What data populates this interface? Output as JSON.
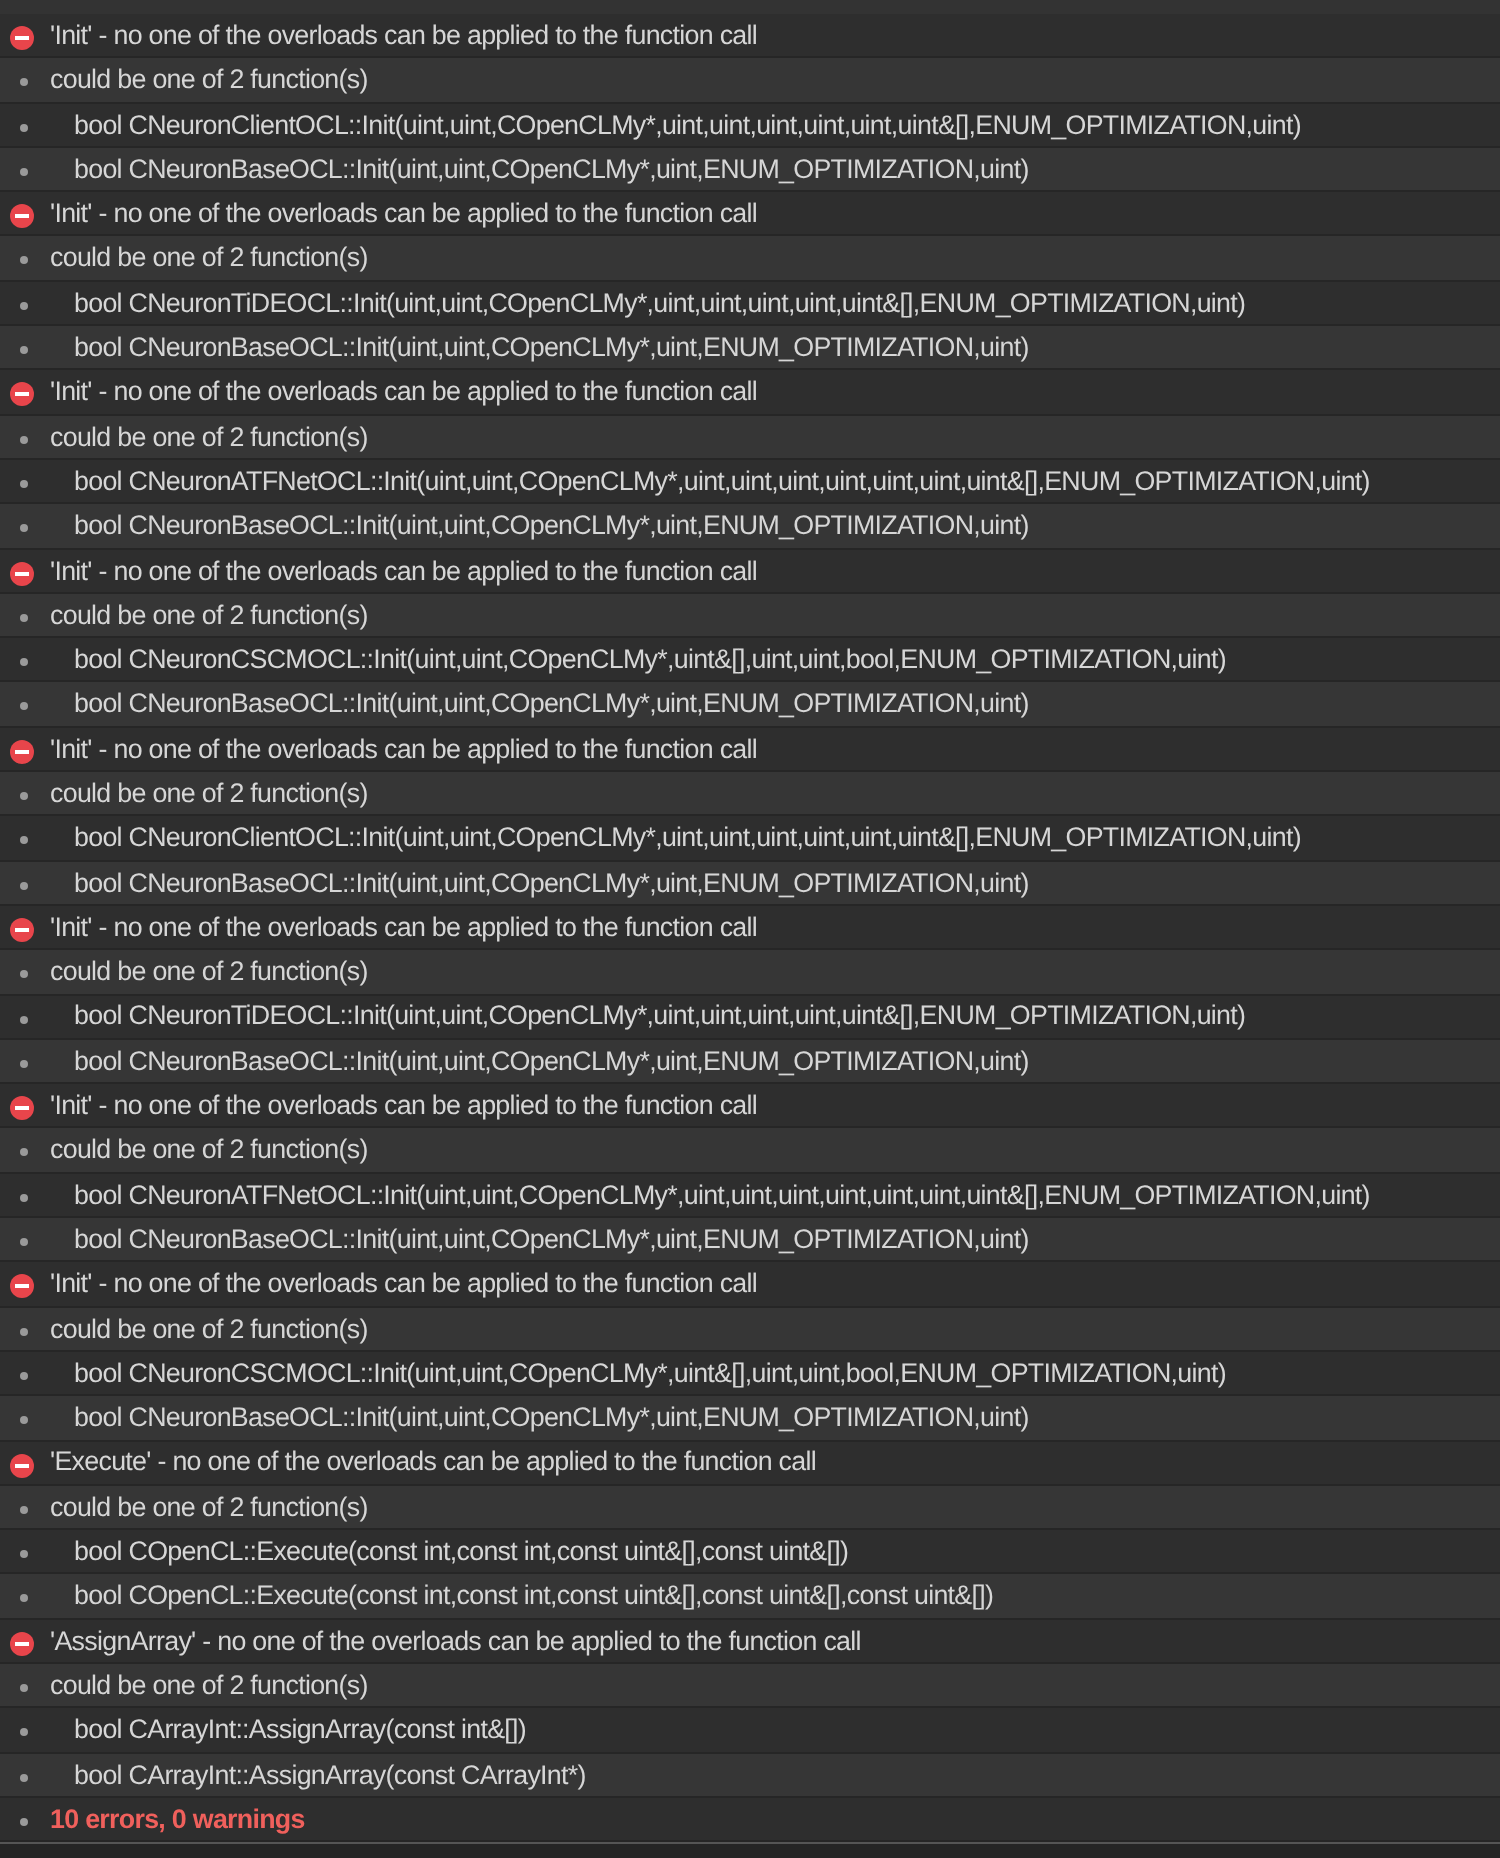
{
  "messages": [
    {
      "kind": "error",
      "text": "'Init' - no one of the overloads can be applied to the function call"
    },
    {
      "kind": "info",
      "text": "could be one of 2 function(s)"
    },
    {
      "kind": "candidate",
      "text": "bool CNeuronClientOCL::Init(uint,uint,COpenCLMy*,uint,uint,uint,uint,uint,uint&[],ENUM_OPTIMIZATION,uint)"
    },
    {
      "kind": "candidate",
      "text": "bool CNeuronBaseOCL::Init(uint,uint,COpenCLMy*,uint,ENUM_OPTIMIZATION,uint)"
    },
    {
      "kind": "error",
      "text": "'Init' - no one of the overloads can be applied to the function call"
    },
    {
      "kind": "info",
      "text": "could be one of 2 function(s)"
    },
    {
      "kind": "candidate",
      "text": "bool CNeuronTiDEOCL::Init(uint,uint,COpenCLMy*,uint,uint,uint,uint,uint&[],ENUM_OPTIMIZATION,uint)"
    },
    {
      "kind": "candidate",
      "text": "bool CNeuronBaseOCL::Init(uint,uint,COpenCLMy*,uint,ENUM_OPTIMIZATION,uint)"
    },
    {
      "kind": "error",
      "text": "'Init' - no one of the overloads can be applied to the function call"
    },
    {
      "kind": "info",
      "text": "could be one of 2 function(s)"
    },
    {
      "kind": "candidate",
      "text": "bool CNeuronATFNetOCL::Init(uint,uint,COpenCLMy*,uint,uint,uint,uint,uint,uint,uint&[],ENUM_OPTIMIZATION,uint)"
    },
    {
      "kind": "candidate",
      "text": "bool CNeuronBaseOCL::Init(uint,uint,COpenCLMy*,uint,ENUM_OPTIMIZATION,uint)"
    },
    {
      "kind": "error",
      "text": "'Init' - no one of the overloads can be applied to the function call"
    },
    {
      "kind": "info",
      "text": "could be one of 2 function(s)"
    },
    {
      "kind": "candidate",
      "text": "bool CNeuronCSCMOCL::Init(uint,uint,COpenCLMy*,uint&[],uint,uint,bool,ENUM_OPTIMIZATION,uint)"
    },
    {
      "kind": "candidate",
      "text": "bool CNeuronBaseOCL::Init(uint,uint,COpenCLMy*,uint,ENUM_OPTIMIZATION,uint)"
    },
    {
      "kind": "error",
      "text": "'Init' - no one of the overloads can be applied to the function call"
    },
    {
      "kind": "info",
      "text": "could be one of 2 function(s)"
    },
    {
      "kind": "candidate",
      "text": "bool CNeuronClientOCL::Init(uint,uint,COpenCLMy*,uint,uint,uint,uint,uint,uint&[],ENUM_OPTIMIZATION,uint)"
    },
    {
      "kind": "candidate",
      "text": "bool CNeuronBaseOCL::Init(uint,uint,COpenCLMy*,uint,ENUM_OPTIMIZATION,uint)"
    },
    {
      "kind": "error",
      "text": "'Init' - no one of the overloads can be applied to the function call"
    },
    {
      "kind": "info",
      "text": "could be one of 2 function(s)"
    },
    {
      "kind": "candidate",
      "text": "bool CNeuronTiDEOCL::Init(uint,uint,COpenCLMy*,uint,uint,uint,uint,uint&[],ENUM_OPTIMIZATION,uint)"
    },
    {
      "kind": "candidate",
      "text": "bool CNeuronBaseOCL::Init(uint,uint,COpenCLMy*,uint,ENUM_OPTIMIZATION,uint)"
    },
    {
      "kind": "error",
      "text": "'Init' - no one of the overloads can be applied to the function call"
    },
    {
      "kind": "info",
      "text": "could be one of 2 function(s)"
    },
    {
      "kind": "candidate",
      "text": "bool CNeuronATFNetOCL::Init(uint,uint,COpenCLMy*,uint,uint,uint,uint,uint,uint,uint&[],ENUM_OPTIMIZATION,uint)"
    },
    {
      "kind": "candidate",
      "text": "bool CNeuronBaseOCL::Init(uint,uint,COpenCLMy*,uint,ENUM_OPTIMIZATION,uint)"
    },
    {
      "kind": "error",
      "text": "'Init' - no one of the overloads can be applied to the function call"
    },
    {
      "kind": "info",
      "text": "could be one of 2 function(s)"
    },
    {
      "kind": "candidate",
      "text": "bool CNeuronCSCMOCL::Init(uint,uint,COpenCLMy*,uint&[],uint,uint,bool,ENUM_OPTIMIZATION,uint)"
    },
    {
      "kind": "candidate",
      "text": "bool CNeuronBaseOCL::Init(uint,uint,COpenCLMy*,uint,ENUM_OPTIMIZATION,uint)"
    },
    {
      "kind": "error",
      "text": "'Execute' - no one of the overloads can be applied to the function call"
    },
    {
      "kind": "info",
      "text": "could be one of 2 function(s)"
    },
    {
      "kind": "candidate",
      "text": "bool COpenCL::Execute(const int,const int,const uint&[],const uint&[])"
    },
    {
      "kind": "candidate",
      "text": "bool COpenCL::Execute(const int,const int,const uint&[],const uint&[],const uint&[])"
    },
    {
      "kind": "error",
      "text": "'AssignArray' - no one of the overloads can be applied to the function call"
    },
    {
      "kind": "info",
      "text": "could be one of 2 function(s)"
    },
    {
      "kind": "candidate",
      "text": "bool CArrayInt::AssignArray(const int&[])"
    },
    {
      "kind": "candidate",
      "text": "bool CArrayInt::AssignArray(const CArrayInt*)"
    },
    {
      "kind": "summary",
      "text": "10 errors, 0 warnings"
    }
  ]
}
